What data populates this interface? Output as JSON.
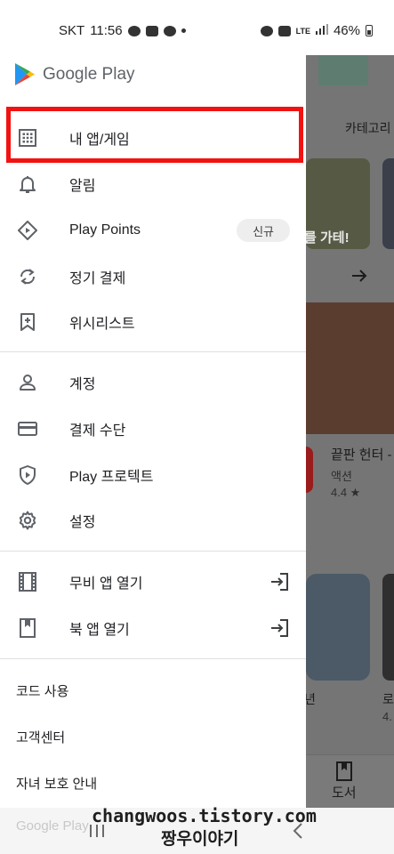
{
  "status_bar": {
    "carrier": "SKT",
    "time": "11:56",
    "network": "LTE",
    "battery": "46%"
  },
  "drawer": {
    "app_name": "Google Play",
    "primary_items": [
      {
        "label": "내 앱/게임",
        "icon": "apps-grid-icon"
      },
      {
        "label": "알림",
        "icon": "bell-icon"
      },
      {
        "label": "Play Points",
        "icon": "play-points-icon",
        "badge": "신규"
      },
      {
        "label": "정기 결제",
        "icon": "refresh-icon"
      },
      {
        "label": "위시리스트",
        "icon": "bookmark-plus-icon"
      }
    ],
    "account_items": [
      {
        "label": "계정",
        "icon": "person-icon"
      },
      {
        "label": "결제 수단",
        "icon": "credit-card-icon"
      },
      {
        "label": "Play 프로텍트",
        "icon": "shield-play-icon"
      },
      {
        "label": "설정",
        "icon": "gear-icon"
      }
    ],
    "app_items": [
      {
        "label": "무비 앱 열기",
        "icon": "film-icon"
      },
      {
        "label": "북 앱 열기",
        "icon": "book-icon"
      }
    ],
    "text_items": [
      "코드 사용",
      "고객센터",
      "자녀 보호 안내"
    ],
    "faded_item": "Google Play"
  },
  "background": {
    "category_tab": "카테고리",
    "banner_text": "를 가테!",
    "game_title": "끝판 헌터 -",
    "game_genre": "액션",
    "game_rating": "4.4 ★",
    "side_label": "로",
    "side_rating": "4.",
    "side_char": "년",
    "books_tab": "도서"
  },
  "watermark": {
    "line1": "changwoos.tistory.com",
    "line2": "짱우이야기"
  },
  "colors": {
    "highlight": "#f21212",
    "scrim": "#757575"
  }
}
